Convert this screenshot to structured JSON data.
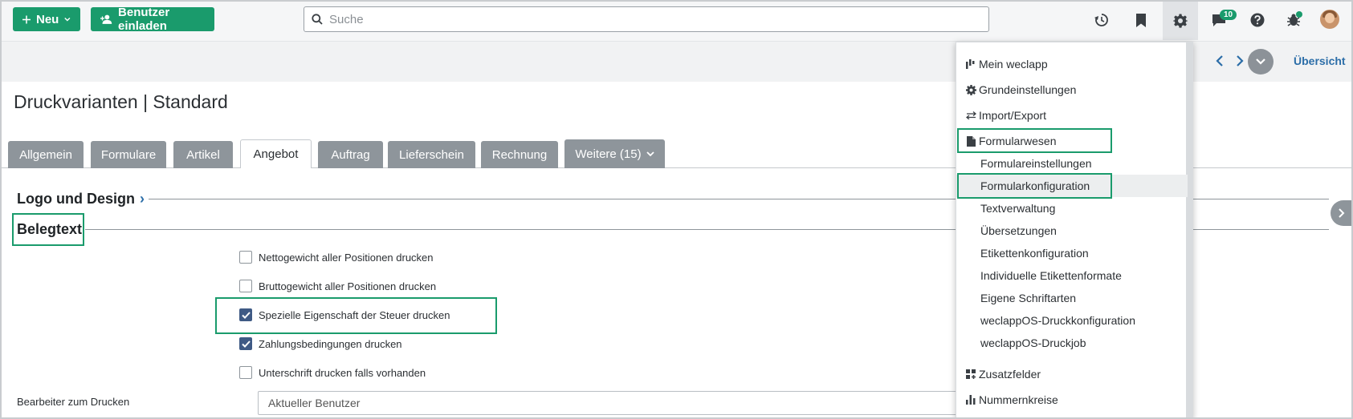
{
  "toolbar": {
    "new_label": "Neu",
    "invite_label": "Benutzer einladen",
    "search_placeholder": "Suche",
    "messages_badge": "10"
  },
  "subbar": {
    "overview_label": "Übersicht"
  },
  "page": {
    "title": "Druckvarianten | Standard",
    "tabs": [
      {
        "label": "Allgemein"
      },
      {
        "label": "Formulare"
      },
      {
        "label": "Artikel"
      },
      {
        "label": "Angebot"
      },
      {
        "label": "Auftrag"
      },
      {
        "label": "Lieferschein"
      },
      {
        "label": "Rechnung"
      },
      {
        "label": "Weitere (15)"
      }
    ],
    "active_tab": "Angebot",
    "sections": {
      "logo_design": "Logo und Design",
      "belegtext": "Belegtext"
    },
    "checkboxes": [
      {
        "label": "Nettogewicht aller Positionen drucken",
        "checked": false
      },
      {
        "label": "Bruttogewicht aller Positionen drucken",
        "checked": false
      },
      {
        "label": "Spezielle Eigenschaft der Steuer drucken",
        "checked": true
      },
      {
        "label": "Zahlungsbedingungen drucken",
        "checked": true
      },
      {
        "label": "Unterschrift drucken falls vorhanden",
        "checked": false
      }
    ],
    "field": {
      "label": "Bearbeiter zum Drucken",
      "value": "Aktueller Benutzer"
    }
  },
  "menu": {
    "items": [
      {
        "label": "Mein weclapp",
        "icon": "bar-chart-icon"
      },
      {
        "label": "Grundeinstellungen",
        "icon": "gear-icon"
      },
      {
        "label": "Import/Export",
        "icon": "swap-arrows-icon"
      },
      {
        "label": "Formularwesen",
        "icon": "document-icon"
      },
      {
        "label": "Formulareinstellungen"
      },
      {
        "label": "Formularkonfiguration"
      },
      {
        "label": "Textverwaltung"
      },
      {
        "label": "Übersetzungen"
      },
      {
        "label": "Etikettenkonfiguration"
      },
      {
        "label": "Individuelle Etikettenformate"
      },
      {
        "label": "Eigene Schriftarten"
      },
      {
        "label": "weclappOS-Druckkonfiguration"
      },
      {
        "label": "weclappOS-Druckjob"
      },
      {
        "label": "Zusatzfelder",
        "icon": "grid-plus-icon"
      },
      {
        "label": "Nummernkreise",
        "icon": "bar-chart-icon"
      }
    ],
    "selected": "Formularkonfiguration"
  },
  "colors": {
    "accent": "#1a9b6c",
    "link": "#2c6ea8",
    "tab_inactive": "#8e959b",
    "checkbox_checked": "#3f5a85"
  }
}
